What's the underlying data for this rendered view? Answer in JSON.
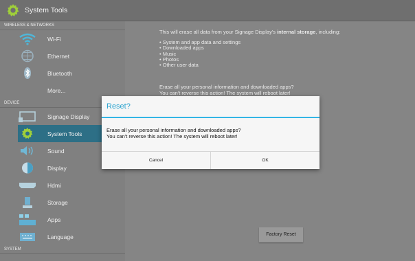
{
  "app": {
    "title": "System Tools",
    "icon": "gear-icon"
  },
  "sidebar": {
    "sections": [
      {
        "header": "Wireless & networks",
        "items": [
          {
            "label": "Wi-Fi",
            "icon": "wifi-icon"
          },
          {
            "label": "Ethernet",
            "icon": "ethernet-icon"
          },
          {
            "label": "Bluetooth",
            "icon": "bluetooth-icon"
          },
          {
            "label": "More...",
            "icon": ""
          }
        ]
      },
      {
        "header": "Device",
        "items": [
          {
            "label": "Signage Display",
            "icon": "signage-display-icon"
          },
          {
            "label": "System Tools",
            "icon": "gear-icon",
            "selected": true
          },
          {
            "label": "Sound",
            "icon": "speaker-icon"
          },
          {
            "label": "Display",
            "icon": "display-icon"
          },
          {
            "label": "Hdmi",
            "icon": "hdmi-icon"
          },
          {
            "label": "Storage",
            "icon": "storage-icon"
          },
          {
            "label": "Apps",
            "icon": "apps-icon"
          },
          {
            "label": "Language",
            "icon": "keyboard-icon"
          }
        ]
      },
      {
        "header": "System",
        "items": []
      }
    ]
  },
  "content": {
    "intro_prefix": "This will erase all data from your Signage Display's ",
    "intro_bold": "internal storage",
    "intro_suffix": ", including:",
    "bullets": [
      "System and app data and settings",
      "Downloaded apps",
      "Music",
      "Photos",
      "Other user data"
    ],
    "warn_line1": "Erase all your personal information and downloaded apps?",
    "warn_line2": "You can't reverse this action! The system will reboot later!",
    "factory_reset_label": "Factory Reset"
  },
  "dialog": {
    "title": "Reset?",
    "message_line1": "Erase all your personal information and downloaded apps?",
    "message_line2": "You can't reverse this action! The system will reboot later!",
    "cancel_label": "Cancel",
    "ok_label": "OK"
  },
  "colors": {
    "accent": "#33b5e5",
    "selected_row": "#2d6f86",
    "dim_background": "#858585"
  }
}
